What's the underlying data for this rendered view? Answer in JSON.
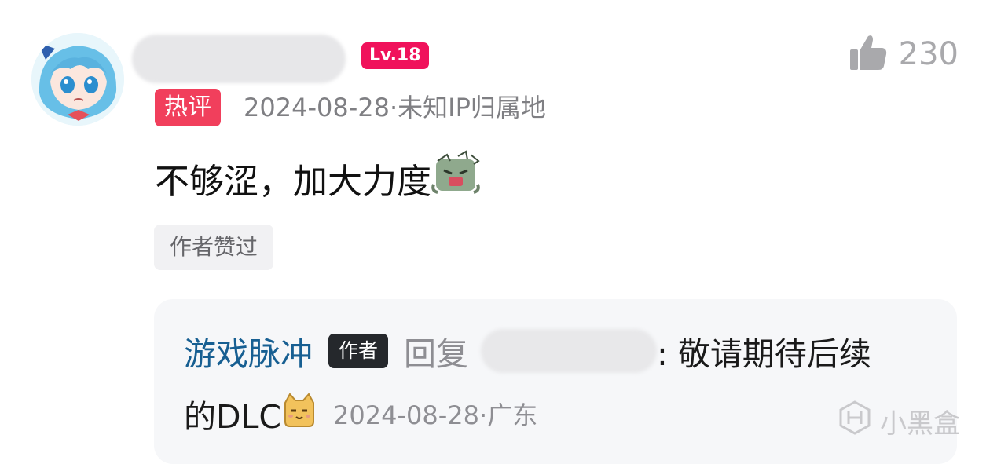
{
  "comment": {
    "level": "Lv.18",
    "likes": "230",
    "hot_tag": "热评",
    "meta": "2024-08-28·未知IP归属地",
    "text": "不够涩，加大力度",
    "author_liked": "作者赞过"
  },
  "reply": {
    "author": "游戏脉冲",
    "author_tag": "作者",
    "reply_word": "回复",
    "text_part1": ": 敬请期待后续",
    "text_part2": "的DLC",
    "meta": "2024-08-28·广东"
  },
  "watermark": {
    "text": "小黑盒"
  },
  "colors": {
    "level_badge": "#f0125b",
    "hot_badge": "#f13f5c",
    "reply_author": "#175f92",
    "reply_bg": "#f6f7f9"
  },
  "icons": [
    "avatar",
    "thumbs-up-icon",
    "zombie-emoji-icon",
    "cat-emoji-icon",
    "xiaoheihe-logo-icon"
  ]
}
